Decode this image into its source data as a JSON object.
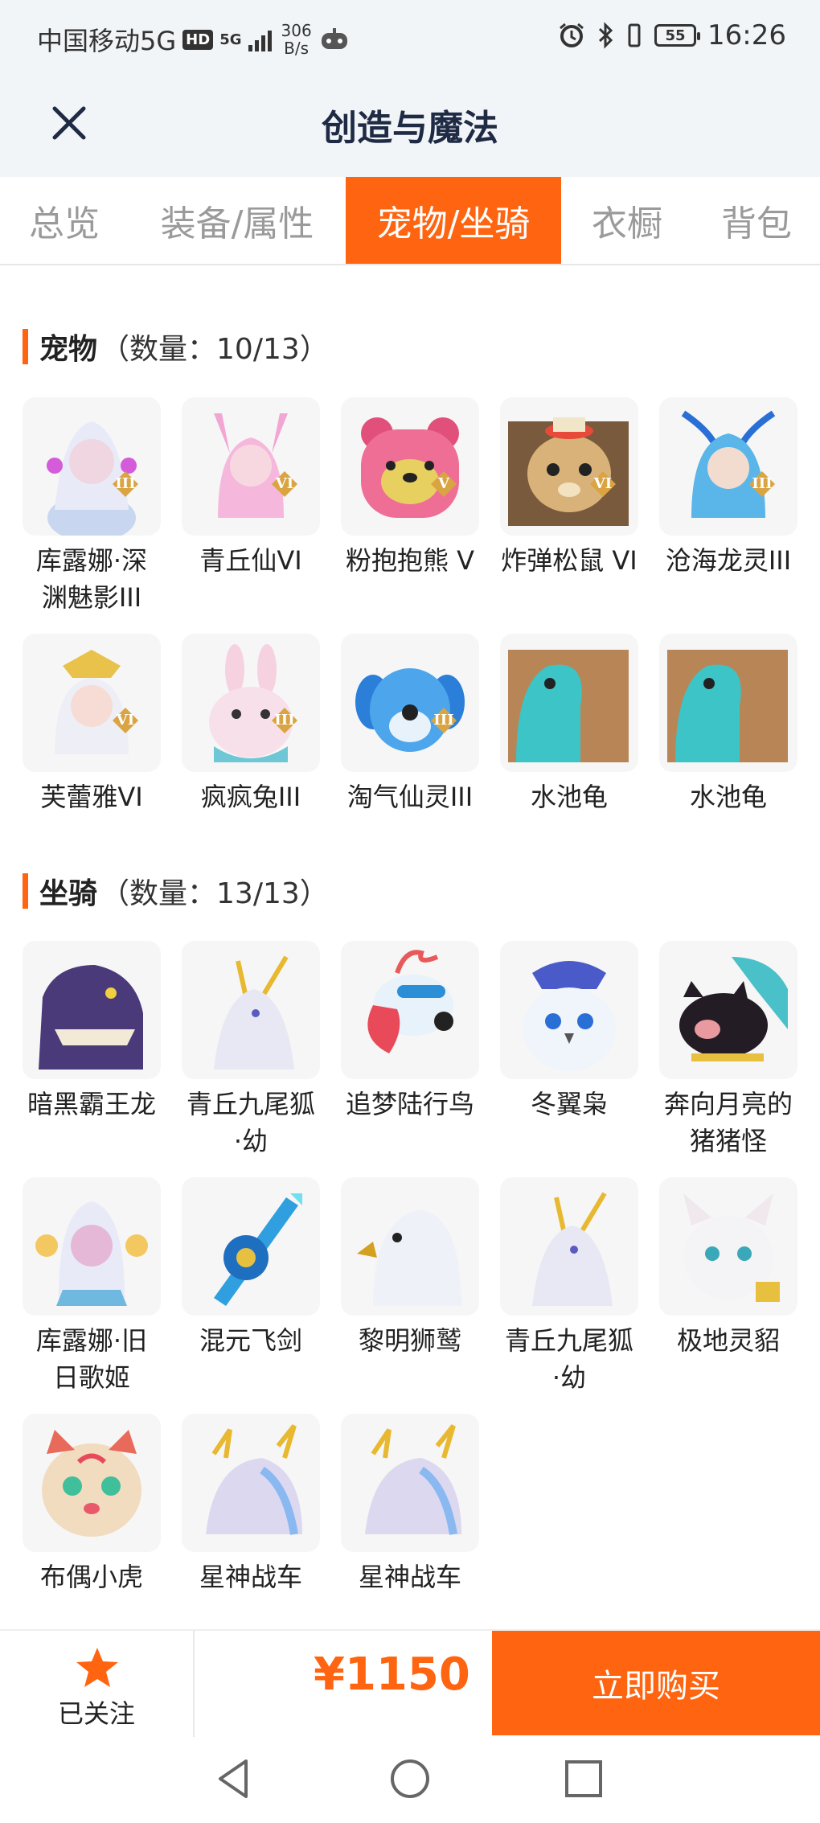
{
  "status_bar": {
    "carrier": "中国移动5G",
    "hd": "HD",
    "net_top": "5G",
    "speed_value": "306",
    "speed_unit": "B/s",
    "battery": "55",
    "time": "16:26"
  },
  "header": {
    "title": "创造与魔法",
    "close_icon": "close-icon"
  },
  "tabs": [
    {
      "label": "总览",
      "active": false
    },
    {
      "label": "装备/属性",
      "active": false
    },
    {
      "label": "宠物/坐骑",
      "active": true
    },
    {
      "label": "衣橱",
      "active": false
    },
    {
      "label": "背包",
      "active": false
    }
  ],
  "pets": {
    "title": "宠物",
    "count": "（数量：10/13）",
    "items": [
      {
        "label": "库露娜·深渊魅影III",
        "line1": "库露娜·深",
        "line2": "渊魅影III",
        "rank": "III"
      },
      {
        "label": "青丘仙VI",
        "line1": "青丘仙VI",
        "line2": "",
        "rank": "VI"
      },
      {
        "label": "粉抱抱熊 V",
        "line1": "粉抱抱熊 V",
        "line2": "",
        "rank": "V"
      },
      {
        "label": "炸弹松鼠 VI",
        "line1": "炸弹松鼠 VI",
        "line2": "",
        "rank": "VI"
      },
      {
        "label": "沧海龙灵III",
        "line1": "沧海龙灵III",
        "line2": "",
        "rank": "III"
      },
      {
        "label": "芙蕾雅VI",
        "line1": "芙蕾雅VI",
        "line2": "",
        "rank": "VI"
      },
      {
        "label": "疯疯兔III",
        "line1": "疯疯兔III",
        "line2": "",
        "rank": "III"
      },
      {
        "label": "淘气仙灵III",
        "line1": "淘气仙灵III",
        "line2": "",
        "rank": "III"
      },
      {
        "label": "水池龟",
        "line1": "水池龟",
        "line2": "",
        "rank": ""
      },
      {
        "label": "水池龟",
        "line1": "水池龟",
        "line2": "",
        "rank": ""
      }
    ]
  },
  "mounts": {
    "title": "坐骑",
    "count": "（数量：13/13）",
    "items": [
      {
        "label": "暗黑霸王龙",
        "line1": "暗黑霸王龙",
        "line2": ""
      },
      {
        "label": "青丘九尾狐·幼",
        "line1": "青丘九尾狐",
        "line2": "·幼"
      },
      {
        "label": "追梦陆行鸟",
        "line1": "追梦陆行鸟",
        "line2": ""
      },
      {
        "label": "冬翼枭",
        "line1": "冬翼枭",
        "line2": ""
      },
      {
        "label": "奔向月亮的猪猪怪",
        "line1": "奔向月亮的",
        "line2": "猪猪怪"
      },
      {
        "label": "库露娜·旧日歌姬",
        "line1": "库露娜·旧",
        "line2": "日歌姬"
      },
      {
        "label": "混元飞剑",
        "line1": "混元飞剑",
        "line2": ""
      },
      {
        "label": "黎明狮鹫",
        "line1": "黎明狮鹫",
        "line2": ""
      },
      {
        "label": "青丘九尾狐·幼",
        "line1": "青丘九尾狐",
        "line2": "·幼"
      },
      {
        "label": "极地灵貂",
        "line1": "极地灵貂",
        "line2": ""
      },
      {
        "label": "布偶小虎",
        "line1": "布偶小虎",
        "line2": ""
      },
      {
        "label": "星神战车",
        "line1": "星神战车",
        "line2": ""
      },
      {
        "label": "星神战车",
        "line1": "星神战车",
        "line2": ""
      }
    ]
  },
  "bottom": {
    "follow_label": "已关注",
    "price": "¥1150",
    "buy_label": "立即购买"
  },
  "colors": {
    "accent": "#ff6410",
    "title": "#1f2a44",
    "header_bg": "#f2f5f8"
  }
}
